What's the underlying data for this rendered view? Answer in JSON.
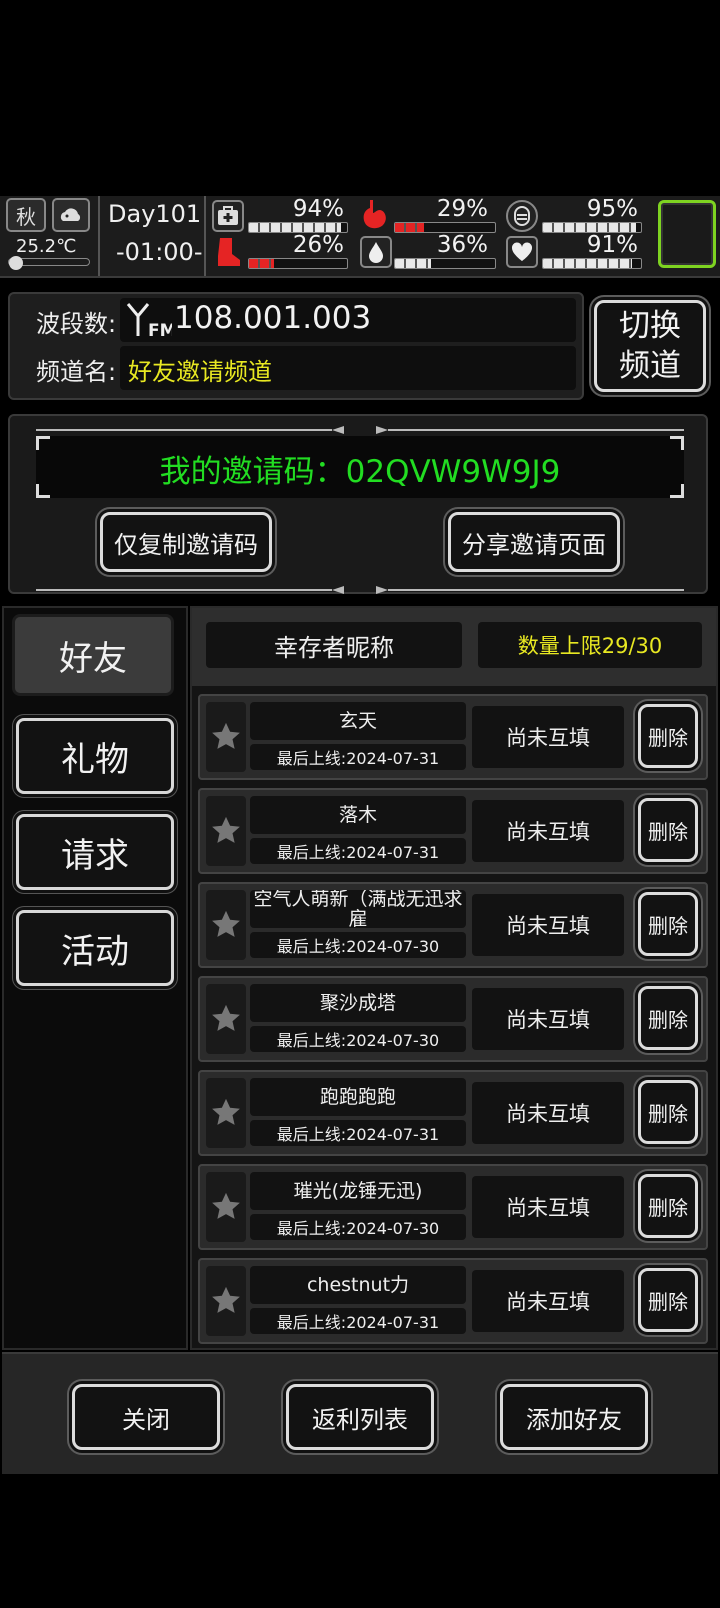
{
  "status": {
    "season": "秋",
    "temperature": "25.2℃",
    "day": "Day101",
    "time": "-01:00-",
    "stats": [
      {
        "name": "health",
        "value": "94%",
        "fill": 0.94,
        "color": "#e8e8e8"
      },
      {
        "name": "hunger",
        "value": "29%",
        "fill": 0.29,
        "color": "#e52424"
      },
      {
        "name": "energy",
        "value": "95%",
        "fill": 0.95,
        "color": "#e8e8e8"
      },
      {
        "name": "fatigue",
        "value": "26%",
        "fill": 0.26,
        "color": "#e52424"
      },
      {
        "name": "thirst",
        "value": "36%",
        "fill": 0.36,
        "color": "#e8e8e8"
      },
      {
        "name": "mood",
        "value": "91%",
        "fill": 0.91,
        "color": "#e8e8e8"
      }
    ]
  },
  "channel": {
    "band_label": "波段数:",
    "band_value": "108.001.003",
    "name_label": "频道名:",
    "name_value": "好友邀请频道",
    "switch_line1": "切换",
    "switch_line2": "频道"
  },
  "invite": {
    "code_text": "我的邀请码：02QVW9W9J9",
    "copy_button": "仅复制邀请码",
    "share_button": "分享邀请页面"
  },
  "tabs": [
    "好友",
    "礼物",
    "请求",
    "活动"
  ],
  "friends_header": {
    "nickname_col": "幸存者昵称",
    "limit": "数量上限29/30"
  },
  "friends": [
    {
      "name": "玄天",
      "last_online": "最后上线:2024-07-31",
      "status": "尚未互填",
      "delete": "删除"
    },
    {
      "name": "落木",
      "last_online": "最后上线:2024-07-31",
      "status": "尚未互填",
      "delete": "删除"
    },
    {
      "name": "空气人萌新（满战无迅求雇",
      "last_online": "最后上线:2024-07-30",
      "status": "尚未互填",
      "delete": "删除"
    },
    {
      "name": "聚沙成塔",
      "last_online": "最后上线:2024-07-30",
      "status": "尚未互填",
      "delete": "删除"
    },
    {
      "name": "跑跑跑跑",
      "last_online": "最后上线:2024-07-31",
      "status": "尚未互填",
      "delete": "删除"
    },
    {
      "name": "璀光(龙锤无迅)",
      "last_online": "最后上线:2024-07-30",
      "status": "尚未互填",
      "delete": "删除"
    },
    {
      "name": "chestnut力",
      "last_online": "最后上线:2024-07-31",
      "status": "尚未互填",
      "delete": "删除"
    }
  ],
  "footer": {
    "close": "关闭",
    "rebate": "返利列表",
    "add_friend": "添加好友"
  },
  "colors": {
    "accent_green": "#22dd22",
    "accent_yellow": "#e8e822",
    "danger_red": "#e52424"
  }
}
